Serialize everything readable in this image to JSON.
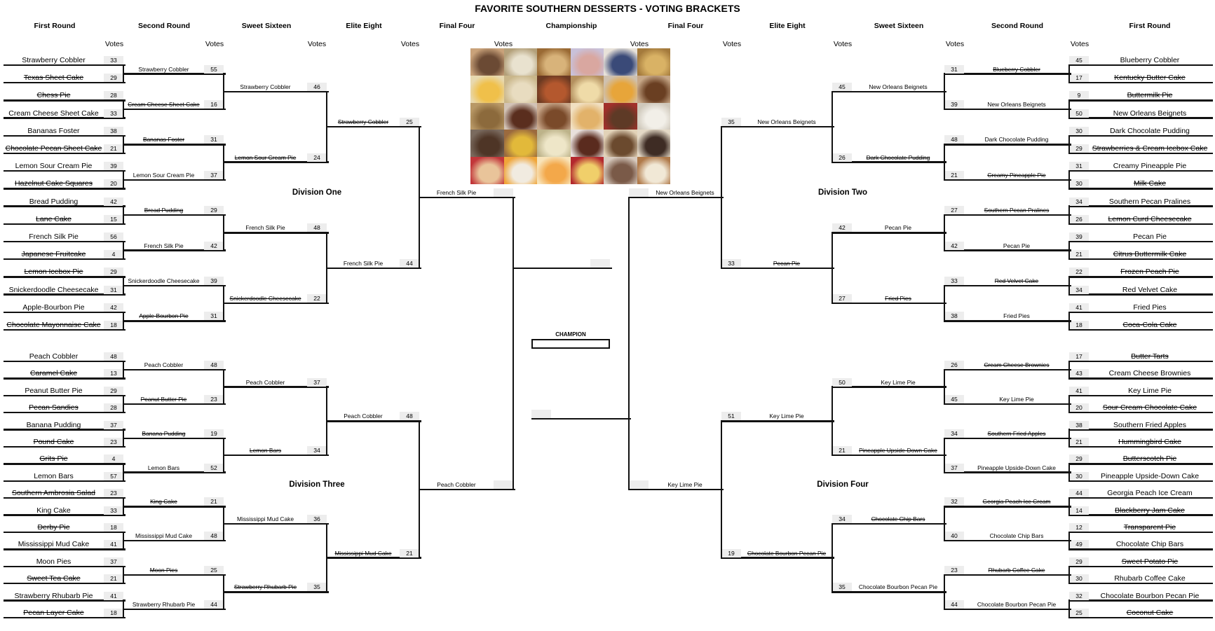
{
  "title": "FAVORITE SOUTHERN DESSERTS - VOTING BRACKETS",
  "headers": {
    "left": [
      "First Round",
      "Second Round",
      "Sweet Sixteen",
      "Elite Eight",
      "Final Four"
    ],
    "center": "Championship",
    "right": [
      "Final Four",
      "Elite Eight",
      "Sweet Sixteen",
      "Second Round",
      "First Round"
    ],
    "votes_label": "Votes"
  },
  "divisions": {
    "one": "Division One",
    "two": "Division Two",
    "three": "Division Three",
    "four": "Division Four"
  },
  "champion_label": "CHAMPION",
  "champion_value": "",
  "brackets": {
    "div1": {
      "r1": [
        {
          "name": "Strawberry Cobbler",
          "votes": "33",
          "out": false
        },
        {
          "name": "Texas Sheet Cake",
          "votes": "29",
          "out": true
        },
        {
          "name": "Chess Pie",
          "votes": "28",
          "out": true
        },
        {
          "name": "Cream Cheese Sheet Cake",
          "votes": "33",
          "out": false
        },
        {
          "name": "Bananas Foster",
          "votes": "38",
          "out": false
        },
        {
          "name": "Chocolate Pecan Sheet Cake",
          "votes": "21",
          "out": true
        },
        {
          "name": "Lemon Sour Cream Pie",
          "votes": "39",
          "out": false
        },
        {
          "name": "Hazelnut Cake Squares",
          "votes": "20",
          "out": true
        },
        {
          "name": "Bread Pudding",
          "votes": "42",
          "out": false
        },
        {
          "name": "Lane Cake",
          "votes": "15",
          "out": true
        },
        {
          "name": "French Silk Pie",
          "votes": "56",
          "out": false
        },
        {
          "name": "Japanese Fruitcake",
          "votes": "4",
          "out": true
        },
        {
          "name": "Lemon Icebox Pie",
          "votes": "29",
          "out": true
        },
        {
          "name": "Snickerdoodle Cheesecake",
          "votes": "31",
          "out": false
        },
        {
          "name": "Apple-Bourbon Pie",
          "votes": "42",
          "out": false
        },
        {
          "name": "Chocolate Mayonnaise Cake",
          "votes": "18",
          "out": true
        }
      ],
      "r2": [
        {
          "name": "Strawberry Cobbler",
          "votes": "55",
          "out": false
        },
        {
          "name": "Cream Cheese Sheet Cake",
          "votes": "16",
          "out": true
        },
        {
          "name": "Bananas Foster",
          "votes": "31",
          "out": true
        },
        {
          "name": "Lemon Sour Cream Pie",
          "votes": "37",
          "out": false
        },
        {
          "name": "Bread Pudding",
          "votes": "29",
          "out": true
        },
        {
          "name": "French Silk Pie",
          "votes": "42",
          "out": false
        },
        {
          "name": "Snickerdoodle Cheesecake",
          "votes": "39",
          "out": false
        },
        {
          "name": "Apple-Bourbon Pie",
          "votes": "31",
          "out": true
        }
      ],
      "r3": [
        {
          "name": "Strawberry Cobbler",
          "votes": "46",
          "out": false
        },
        {
          "name": "Lemon Sour Cream Pie",
          "votes": "24",
          "out": true
        },
        {
          "name": "French Silk Pie",
          "votes": "48",
          "out": false
        },
        {
          "name": "Snickerdoodle Cheesecake",
          "votes": "22",
          "out": true
        }
      ],
      "r4": [
        {
          "name": "Strawberry Cobbler",
          "votes": "25",
          "out": true
        },
        {
          "name": "French Silk Pie",
          "votes": "44",
          "out": false
        }
      ],
      "r5": {
        "name": "French Silk Pie",
        "votes": "",
        "out": false
      }
    },
    "div3": {
      "r1": [
        {
          "name": "Peach Cobbler",
          "votes": "48",
          "out": false
        },
        {
          "name": "Caramel Cake",
          "votes": "13",
          "out": true
        },
        {
          "name": "Peanut Butter Pie",
          "votes": "29",
          "out": false
        },
        {
          "name": "Pecan Sandies",
          "votes": "28",
          "out": true
        },
        {
          "name": "Banana Pudding",
          "votes": "37",
          "out": false
        },
        {
          "name": "Pound Cake",
          "votes": "23",
          "out": true
        },
        {
          "name": "Grits Pie",
          "votes": "4",
          "out": true
        },
        {
          "name": "Lemon Bars",
          "votes": "57",
          "out": false
        },
        {
          "name": "Southern Ambrosia Salad",
          "votes": "23",
          "out": true
        },
        {
          "name": "King Cake",
          "votes": "33",
          "out": false
        },
        {
          "name": "Derby Pie",
          "votes": "18",
          "out": true
        },
        {
          "name": "Mississippi Mud Cake",
          "votes": "41",
          "out": false
        },
        {
          "name": "Moon Pies",
          "votes": "37",
          "out": false
        },
        {
          "name": "Sweet Tea Cake",
          "votes": "21",
          "out": true
        },
        {
          "name": "Strawberry Rhubarb Pie",
          "votes": "41",
          "out": false
        },
        {
          "name": "Pecan Layer Cake",
          "votes": "18",
          "out": true
        }
      ],
      "r2": [
        {
          "name": "Peach Cobbler",
          "votes": "48",
          "out": false
        },
        {
          "name": "Peanut Butter Pie",
          "votes": "23",
          "out": true
        },
        {
          "name": "Banana Pudding",
          "votes": "19",
          "out": true
        },
        {
          "name": "Lemon Bars",
          "votes": "52",
          "out": false
        },
        {
          "name": "King Cake",
          "votes": "21",
          "out": true
        },
        {
          "name": "Mississippi Mud Cake",
          "votes": "48",
          "out": false
        },
        {
          "name": "Moon Pies",
          "votes": "25",
          "out": true
        },
        {
          "name": "Strawberry Rhubarb Pie",
          "votes": "44",
          "out": false
        }
      ],
      "r3": [
        {
          "name": "Peach Cobbler",
          "votes": "37",
          "out": false
        },
        {
          "name": "Lemon Bars",
          "votes": "34",
          "out": true
        },
        {
          "name": "Mississippi Mud Cake",
          "votes": "36",
          "out": false
        },
        {
          "name": "Strawberry Rhubarb Pie",
          "votes": "35",
          "out": true
        }
      ],
      "r4": [
        {
          "name": "Peach Cobbler",
          "votes": "48",
          "out": false
        },
        {
          "name": "Mississippi Mud Cake",
          "votes": "21",
          "out": true
        }
      ],
      "r5": {
        "name": "Peach Cobbler",
        "votes": "",
        "out": false
      }
    },
    "div2": {
      "r1": [
        {
          "name": "Blueberry Cobbler",
          "votes": "45",
          "out": false
        },
        {
          "name": "Kentucky Butter Cake",
          "votes": "17",
          "out": true
        },
        {
          "name": "Buttermilk Pie",
          "votes": "9",
          "out": true
        },
        {
          "name": "New Orleans Beignets",
          "votes": "50",
          "out": false
        },
        {
          "name": "Dark Chocolate Pudding",
          "votes": "30",
          "out": false
        },
        {
          "name": "Strawberries & Cream Icebox Cake",
          "votes": "29",
          "out": true
        },
        {
          "name": "Creamy Pineapple Pie",
          "votes": "31",
          "out": false
        },
        {
          "name": "Milk Cake",
          "votes": "30",
          "out": true
        },
        {
          "name": "Southern Pecan Pralines",
          "votes": "34",
          "out": false
        },
        {
          "name": "Lemon Curd Cheesecake",
          "votes": "26",
          "out": true
        },
        {
          "name": "Pecan Pie",
          "votes": "39",
          "out": false
        },
        {
          "name": "Citrus Buttermilk Cake",
          "votes": "21",
          "out": true
        },
        {
          "name": "Frozen Peach Pie",
          "votes": "22",
          "out": true
        },
        {
          "name": "Red Velvet Cake",
          "votes": "34",
          "out": false
        },
        {
          "name": "Fried Pies",
          "votes": "41",
          "out": false
        },
        {
          "name": "Coca-Cola Cake",
          "votes": "18",
          "out": true
        }
      ],
      "r2": [
        {
          "name": "Blueberry Cobbler",
          "votes": "31",
          "out": true
        },
        {
          "name": "New Orleans Beignets",
          "votes": "39",
          "out": false
        },
        {
          "name": "Dark Chocolate Pudding",
          "votes": "48",
          "out": false
        },
        {
          "name": "Creamy Pineapple Pie",
          "votes": "21",
          "out": true
        },
        {
          "name": "Southern Pecan Pralines",
          "votes": "27",
          "out": true
        },
        {
          "name": "Pecan Pie",
          "votes": "42",
          "out": false
        },
        {
          "name": "Red Velvet Cake",
          "votes": "33",
          "out": true
        },
        {
          "name": "Fried Pies",
          "votes": "38",
          "out": false
        }
      ],
      "r3": [
        {
          "name": "New Orleans Beignets",
          "votes": "45",
          "out": false
        },
        {
          "name": "Dark Chocolate Pudding",
          "votes": "26",
          "out": true
        },
        {
          "name": "Pecan Pie",
          "votes": "42",
          "out": false
        },
        {
          "name": "Fried Pies",
          "votes": "27",
          "out": true
        }
      ],
      "r4": [
        {
          "name": "New Orleans Beignets",
          "votes": "35",
          "out": false
        },
        {
          "name": "Pecan Pie",
          "votes": "33",
          "out": true
        }
      ],
      "r5": {
        "name": "New Orleans Beignets",
        "votes": "",
        "out": false
      }
    },
    "div4": {
      "r1": [
        {
          "name": "Butter Tarts",
          "votes": "17",
          "out": true
        },
        {
          "name": "Cream Cheese Brownies",
          "votes": "43",
          "out": false
        },
        {
          "name": "Key Lime Pie",
          "votes": "41",
          "out": false
        },
        {
          "name": "Sour Cream Chocolate Cake",
          "votes": "20",
          "out": true
        },
        {
          "name": "Southern Fried Apples",
          "votes": "38",
          "out": false
        },
        {
          "name": "Hummingbird Cake",
          "votes": "21",
          "out": true
        },
        {
          "name": "Butterscotch Pie",
          "votes": "29",
          "out": true
        },
        {
          "name": "Pineapple Upside-Down Cake",
          "votes": "30",
          "out": false
        },
        {
          "name": "Georgia Peach Ice Cream",
          "votes": "44",
          "out": false
        },
        {
          "name": "Blackberry Jam Cake",
          "votes": "14",
          "out": true
        },
        {
          "name": "Transparent Pie",
          "votes": "12",
          "out": true
        },
        {
          "name": "Chocolate Chip Bars",
          "votes": "49",
          "out": false
        },
        {
          "name": "Sweet Potato Pie",
          "votes": "29",
          "out": true
        },
        {
          "name": "Rhubarb Coffee Cake",
          "votes": "30",
          "out": false
        },
        {
          "name": "Chocolate Bourbon Pecan Pie",
          "votes": "32",
          "out": false
        },
        {
          "name": "Coconut Cake",
          "votes": "25",
          "out": true
        }
      ],
      "r2": [
        {
          "name": "Cream Cheese Brownies",
          "votes": "26",
          "out": true
        },
        {
          "name": "Key Lime Pie",
          "votes": "45",
          "out": false
        },
        {
          "name": "Southern Fried Apples",
          "votes": "34",
          "out": true
        },
        {
          "name": "Pineapple Upside-Down Cake",
          "votes": "37",
          "out": false
        },
        {
          "name": "Georgia Peach Ice Cream",
          "votes": "32",
          "out": true
        },
        {
          "name": "Chocolate Chip Bars",
          "votes": "40",
          "out": false
        },
        {
          "name": "Rhubarb Coffee Cake",
          "votes": "23",
          "out": true
        },
        {
          "name": "Chocolate Bourbon Pecan Pie",
          "votes": "44",
          "out": false
        }
      ],
      "r3": [
        {
          "name": "Key Lime Pie",
          "votes": "50",
          "out": false
        },
        {
          "name": "Pineapple Upside-Down Cake",
          "votes": "21",
          "out": true
        },
        {
          "name": "Chocolate Chip Bars",
          "votes": "34",
          "out": true
        },
        {
          "name": "Chocolate Bourbon Pecan Pie",
          "votes": "35",
          "out": false
        }
      ],
      "r4": [
        {
          "name": "Key Lime Pie",
          "votes": "51",
          "out": false
        },
        {
          "name": "Chocolate Bourbon Pecan Pie",
          "votes": "19",
          "out": true
        }
      ],
      "r5": {
        "name": "Key Lime Pie",
        "votes": "",
        "out": false
      }
    }
  },
  "championship": {
    "left_finalist_votes": "",
    "right_finalist_votes": ""
  },
  "gallery": {
    "alt": "Collage of southern dessert photos",
    "tiles": [
      {
        "label": "cobbler",
        "colors": [
          "#6b4a34",
          "#c9a27a"
        ]
      },
      {
        "label": "cream pie",
        "colors": [
          "#e9e2cf",
          "#b3a07a"
        ]
      },
      {
        "label": "bananas foster",
        "colors": [
          "#d8b37a",
          "#9a6a34"
        ]
      },
      {
        "label": "bundt cake",
        "colors": [
          "#d9a7a0",
          "#c9c1d9"
        ]
      },
      {
        "label": "blueberry cobbler",
        "colors": [
          "#3a4a78",
          "#e8e2d9"
        ]
      },
      {
        "label": "bread pudding",
        "colors": [
          "#d9b265",
          "#a47a3c"
        ]
      },
      {
        "label": "lemon pie",
        "colors": [
          "#f0c04a",
          "#e8d9b0"
        ]
      },
      {
        "label": "meringue pie",
        "colors": [
          "#e8dcc0",
          "#c9b68a"
        ]
      },
      {
        "label": "tarts",
        "colors": [
          "#b4582e",
          "#6b3a22"
        ]
      },
      {
        "label": "layer cake",
        "colors": [
          "#efdba8",
          "#b38f5e"
        ]
      },
      {
        "label": "chess pie",
        "colors": [
          "#e7a53a",
          "#cfc1b0"
        ]
      },
      {
        "label": "pecan pie",
        "colors": [
          "#6a3f22",
          "#c7a888"
        ]
      },
      {
        "label": "blondies",
        "colors": [
          "#8c6a3c",
          "#b89866"
        ]
      },
      {
        "label": "chocolate cake",
        "colors": [
          "#5a2e1e",
          "#d2c3b6"
        ]
      },
      {
        "label": "sheet cake",
        "colors": [
          "#7a4a2a",
          "#c9a88b"
        ]
      },
      {
        "label": "pound cake",
        "colors": [
          "#e2b26a",
          "#f1e0c2"
        ]
      },
      {
        "label": "brownie",
        "colors": [
          "#5e3a26",
          "#a1302b"
        ]
      },
      {
        "label": "coconut cake",
        "colors": [
          "#f2efe8",
          "#cfc8bb"
        ]
      },
      {
        "label": "fudge bars",
        "colors": [
          "#4e3526",
          "#7a6a5e"
        ]
      },
      {
        "label": "lemon bars",
        "colors": [
          "#e2b93a",
          "#9b6a3e"
        ]
      },
      {
        "label": "banana pudding",
        "colors": [
          "#eee6c8",
          "#bdb38a"
        ]
      },
      {
        "label": "chocolate pudding",
        "colors": [
          "#5a2b1e",
          "#e8e0dc"
        ]
      },
      {
        "label": "derby pie",
        "colors": [
          "#6b4a2e",
          "#e2d2b8"
        ]
      },
      {
        "label": "chocolate chip pie",
        "colors": [
          "#3e2c24",
          "#e4d9c6"
        ]
      },
      {
        "label": "fried pies",
        "colors": [
          "#e9c49a",
          "#c2363a"
        ]
      },
      {
        "label": "cheesecake",
        "colors": [
          "#f1ebe0",
          "#f0a63a"
        ]
      },
      {
        "label": "peach ice cream",
        "colors": [
          "#f3a84a",
          "#f8e3b8"
        ]
      },
      {
        "label": "key lime pie",
        "colors": [
          "#f0cf6a",
          "#b3282e"
        ]
      },
      {
        "label": "chocolate bars",
        "colors": [
          "#7a5a48",
          "#d8cbbf"
        ]
      },
      {
        "label": "caramel cake",
        "colors": [
          "#f1e8d6",
          "#b07a4a"
        ]
      }
    ]
  }
}
